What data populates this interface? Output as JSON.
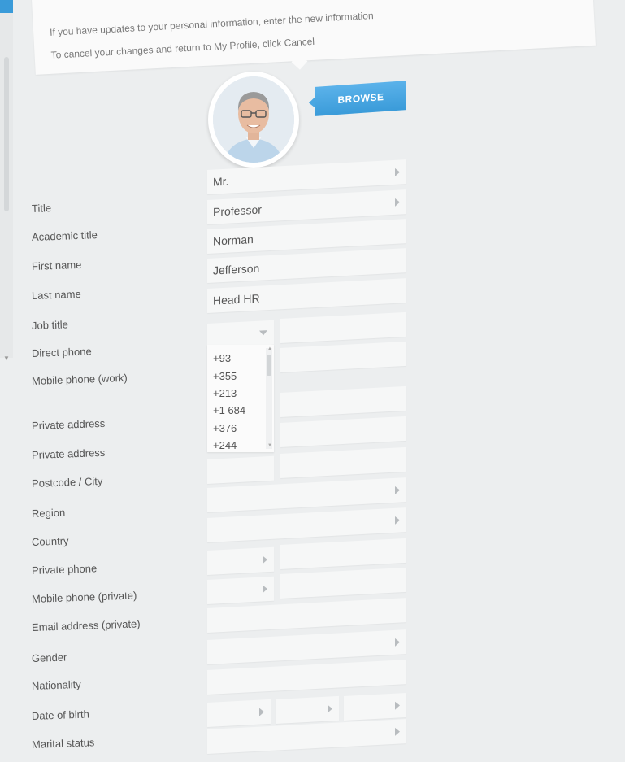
{
  "info": {
    "line1": "If you have updates to your personal information, enter the new information",
    "line2": "To cancel your changes and return to My Profile, click Cancel"
  },
  "browse_label": "BROWSE",
  "labels": {
    "title": "Title",
    "academic_title": "Academic title",
    "first_name": "First name",
    "last_name": "Last name",
    "job_title": "Job title",
    "direct_phone": "Direct phone",
    "mobile_work": "Mobile phone (work)",
    "private_address_1": "Private address",
    "private_address_2": "Private address",
    "postcode_city": "Postcode / City",
    "region": "Region",
    "country": "Country",
    "private_phone": "Private phone",
    "mobile_private": "Mobile phone (private)",
    "email_private": "Email address (private)",
    "gender": "Gender",
    "nationality": "Nationality",
    "date_of_birth": "Date of birth",
    "marital_status": "Marital status"
  },
  "values": {
    "title": "Mr.",
    "academic_title": "Professor",
    "first_name": "Norman",
    "last_name": "Jefferson",
    "job_title": "Head HR"
  },
  "country_codes": [
    "+93",
    "+355",
    "+213",
    "+1 684",
    "+376",
    "+244"
  ],
  "icons": {
    "select_arrow": "triangle-right-icon",
    "dropdown_arrow": "triangle-down-icon"
  },
  "colors": {
    "accent": "#3a9bd9",
    "background": "#eceeef",
    "field": "#f6f7f7"
  }
}
